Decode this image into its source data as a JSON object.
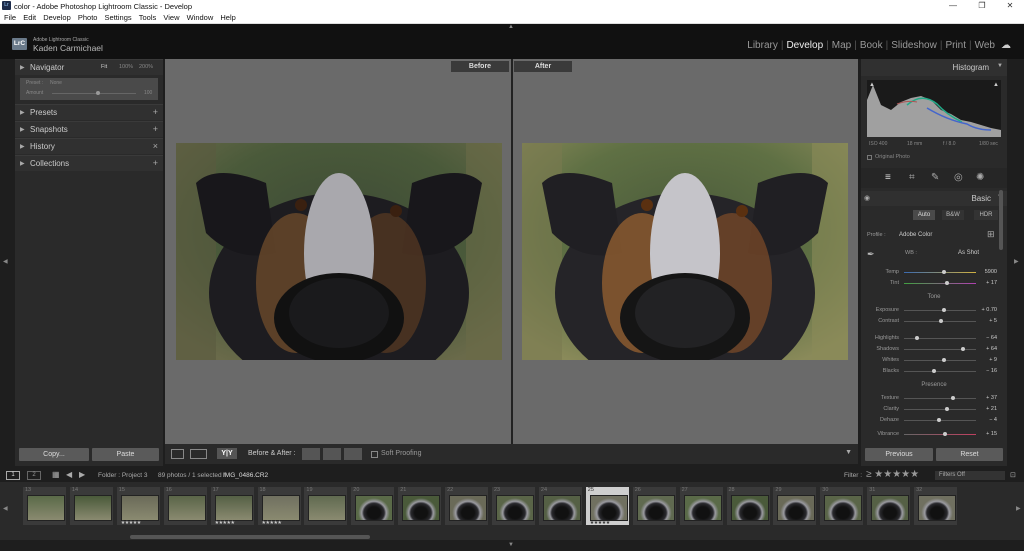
{
  "window": {
    "title": "color - Adobe Photoshop Lightroom Classic - Develop",
    "logo": "Lr"
  },
  "menu": [
    "File",
    "Edit",
    "Develop",
    "Photo",
    "Settings",
    "Tools",
    "View",
    "Window",
    "Help"
  ],
  "identity": {
    "logo": "LrC",
    "app": "Adobe Lightroom Classic",
    "user": "Kaden Carmichael"
  },
  "modules": [
    "Library",
    "Develop",
    "Map",
    "Book",
    "Slideshow",
    "Print",
    "Web"
  ],
  "active_module": "Develop",
  "left": {
    "navigator": {
      "label": "Navigator",
      "zooms": [
        "Fit",
        "100%",
        "200%"
      ]
    },
    "preset_amount": {
      "preset_label": "Preset :",
      "preset_value": "None",
      "amount_label": "Amount",
      "amount_value": "100"
    },
    "panels": [
      "Presets",
      "Snapshots",
      "History",
      "Collections"
    ],
    "copy": "Copy...",
    "paste": "Paste"
  },
  "center": {
    "before": "Before",
    "after": "After"
  },
  "toolbar": {
    "ba_label": "Before & After :",
    "yy": "Y|Y",
    "soft_proofing": "Soft Proofing"
  },
  "right": {
    "histogram": "Histogram",
    "exif": [
      "ISO 400",
      "18 mm",
      "f / 8.0",
      "1/80 sec"
    ],
    "original_photo": "Original Photo",
    "basic": "Basic",
    "modes": [
      "Auto",
      "B&W",
      "HDR"
    ],
    "profile_label": "Profile :",
    "profile_value": "Adobe Color",
    "wb_label": "WB :",
    "wb_value": "As Shot",
    "sliders_wb": [
      {
        "name": "Temp",
        "value": "5900",
        "pos": 0.55
      },
      {
        "name": "Tint",
        "value": "+ 17",
        "pos": 0.6
      }
    ],
    "tone": "Tone",
    "sliders_tone": [
      {
        "name": "Exposure",
        "value": "+ 0.70",
        "pos": 0.56
      },
      {
        "name": "Contrast",
        "value": "+ 5",
        "pos": 0.52
      }
    ],
    "sliders_tone2": [
      {
        "name": "Highlights",
        "value": "− 64",
        "pos": 0.18
      },
      {
        "name": "Shadows",
        "value": "+ 64",
        "pos": 0.82
      },
      {
        "name": "Whites",
        "value": "+ 9",
        "pos": 0.55
      },
      {
        "name": "Blacks",
        "value": "− 16",
        "pos": 0.42
      }
    ],
    "presence": "Presence",
    "sliders_presence": [
      {
        "name": "Texture",
        "value": "+ 37",
        "pos": 0.68
      },
      {
        "name": "Clarity",
        "value": "+ 21",
        "pos": 0.6
      },
      {
        "name": "Dehaze",
        "value": "− 4",
        "pos": 0.48
      },
      {
        "name": "Vibrance",
        "value": "+ 15",
        "pos": 0.57
      }
    ],
    "previous": "Previous",
    "reset": "Reset"
  },
  "filmbar": {
    "pages": [
      "1",
      "2"
    ],
    "folder": "Folder : Project 3",
    "count": "89 photos / 1 selected /",
    "file": "IMG_0486.CR2",
    "filter": "Filter :",
    "filters_off": "Filters Off"
  },
  "filmstrip": {
    "numbers": [
      "13",
      "14",
      "15",
      "16",
      "17",
      "18",
      "19",
      "20",
      "21",
      "22",
      "23",
      "24",
      "25",
      "26",
      "27",
      "28",
      "29",
      "30",
      "31",
      "32"
    ],
    "stars": [
      "",
      "",
      "★★★★★",
      "",
      "★★★★★",
      "★★★★★",
      "",
      "",
      "",
      "",
      "",
      "",
      "★★★★★",
      "",
      "",
      "",
      "",
      "",
      "",
      ""
    ],
    "selected_index": 12
  },
  "colors": {
    "accent": "#e0e0e0",
    "panel": "#2a2a2a",
    "background": "#1e1e1e",
    "canvas": "#6a6a6a"
  }
}
